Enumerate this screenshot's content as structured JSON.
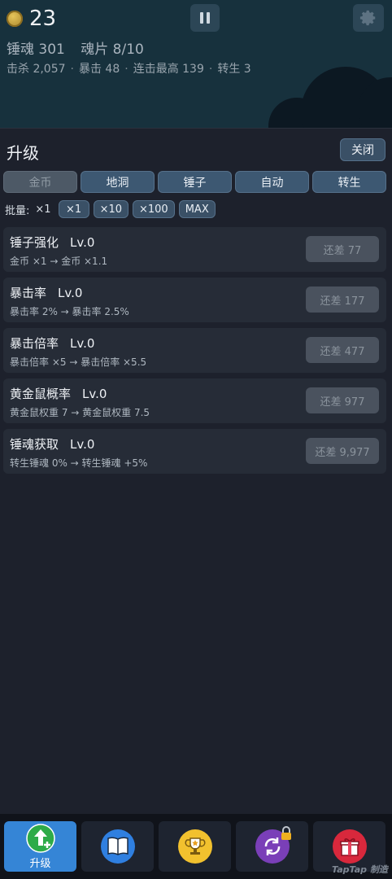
{
  "hud": {
    "coins": "23",
    "soul_text": "锤魂 301",
    "shard_text": "魂片 8/10",
    "stats": [
      "击杀 2,057",
      "暴击 48",
      "连击最高 139",
      "转生 3"
    ],
    "stats_sep": "·"
  },
  "panel": {
    "title": "升级",
    "close_label": "关闭",
    "tabs": [
      "金币",
      "地洞",
      "锤子",
      "自动",
      "转生"
    ],
    "active_tab": "金币",
    "batch_label": "批量:",
    "batch_current": "×1",
    "batch_options": [
      "×1",
      "×10",
      "×100",
      "MAX"
    ]
  },
  "upgrades": [
    {
      "name": "锤子强化",
      "level": "Lv.0",
      "desc": "金币 ×1 → 金币 ×1.1",
      "cost": "还差 77"
    },
    {
      "name": "暴击率",
      "level": "Lv.0",
      "desc": "暴击率 2% → 暴击率 2.5%",
      "cost": "还差 177"
    },
    {
      "name": "暴击倍率",
      "level": "Lv.0",
      "desc": "暴击倍率 ×5 → 暴击倍率 ×5.5",
      "cost": "还差 477"
    },
    {
      "name": "黄金鼠概率",
      "level": "Lv.0",
      "desc": "黄金鼠权重 7 → 黄金鼠权重 7.5",
      "cost": "还差 977"
    },
    {
      "name": "锤魂获取",
      "level": "Lv.0",
      "desc": "转生锤魂 0% → 转生锤魂 +5%",
      "cost": "还差 9,977"
    }
  ],
  "nav": {
    "upgrade_label": "升级",
    "icons": [
      "upgrade-arrow-icon",
      "book-icon",
      "trophy-icon",
      "rebirth-locked-icon",
      "gift-icon"
    ]
  },
  "watermark": "TapTap 制造",
  "colors": {
    "active_nav": "#3585d6",
    "tab": "#3d5872",
    "coin": "#d4b24a"
  }
}
